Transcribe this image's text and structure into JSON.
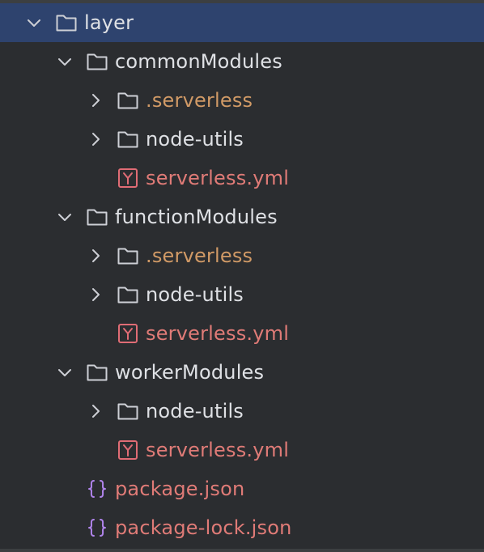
{
  "tree": {
    "rows": [
      {
        "depth": 0,
        "kind": "folder",
        "expanded": true,
        "label": "layer",
        "selected": true
      },
      {
        "depth": 1,
        "kind": "folder",
        "expanded": true,
        "label": "commonModules"
      },
      {
        "depth": 2,
        "kind": "folder",
        "expanded": false,
        "label": ".serverless",
        "color": "excluded"
      },
      {
        "depth": 2,
        "kind": "folder",
        "expanded": false,
        "label": "node-utils"
      },
      {
        "depth": 2,
        "kind": "yml",
        "label": "serverless.yml",
        "color": "yml"
      },
      {
        "depth": 1,
        "kind": "folder",
        "expanded": true,
        "label": "functionModules"
      },
      {
        "depth": 2,
        "kind": "folder",
        "expanded": false,
        "label": ".serverless",
        "color": "excluded"
      },
      {
        "depth": 2,
        "kind": "folder",
        "expanded": false,
        "label": "node-utils"
      },
      {
        "depth": 2,
        "kind": "yml",
        "label": "serverless.yml",
        "color": "yml"
      },
      {
        "depth": 1,
        "kind": "folder",
        "expanded": true,
        "label": "workerModules"
      },
      {
        "depth": 2,
        "kind": "folder",
        "expanded": false,
        "label": "node-utils"
      },
      {
        "depth": 2,
        "kind": "yml",
        "label": "serverless.yml",
        "color": "yml"
      },
      {
        "depth": 1,
        "kind": "json",
        "label": "package.json",
        "color": "json"
      },
      {
        "depth": 1,
        "kind": "json",
        "label": "package-lock.json",
        "color": "json"
      }
    ]
  },
  "icons": {
    "folder": "folder-icon",
    "yml": "yaml-file-icon",
    "json": "json-file-icon",
    "expanded": "chevron-down-icon",
    "collapsed": "chevron-right-icon"
  },
  "colors": {
    "background": "#2b2d30",
    "selection": "#2e436e",
    "folder_text": "#dfe1e5",
    "excluded_text": "#d19a66",
    "file_text": "#e07b77",
    "yml_icon": "#e06c75",
    "json_icon": "#b084eb"
  }
}
